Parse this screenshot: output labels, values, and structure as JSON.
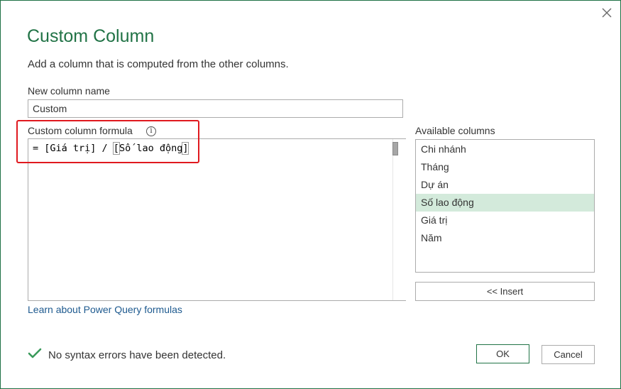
{
  "dialog": {
    "title": "Custom Column",
    "subtitle": "Add a column that is computed from the other columns."
  },
  "name_field": {
    "label": "New column name",
    "value": "Custom"
  },
  "formula": {
    "label": "Custom column formula",
    "info_icon_glyph": "i",
    "text_before": "= [Giá trị] / ",
    "text_bracket_open": "[",
    "text_middle": "Số lao động",
    "text_bracket_close": "]"
  },
  "available_columns": {
    "label": "Available columns",
    "items": [
      {
        "label": "Chi nhánh",
        "selected": false
      },
      {
        "label": "Tháng",
        "selected": false
      },
      {
        "label": "Dự án",
        "selected": false
      },
      {
        "label": "Số lao động",
        "selected": true
      },
      {
        "label": "Giá trị",
        "selected": false
      },
      {
        "label": "Năm",
        "selected": false
      }
    ],
    "insert_label": "<< Insert"
  },
  "help_link": "Learn about Power Query formulas",
  "status": {
    "message": "No syntax errors have been detected.",
    "icon": "check-icon",
    "color": "#3a9a5b"
  },
  "buttons": {
    "ok_label": "OK",
    "cancel_label": "Cancel"
  },
  "colors": {
    "accent": "#217346",
    "highlight_border": "#e0191f",
    "selected_row": "#d3eadb",
    "link": "#1e5a8f"
  }
}
